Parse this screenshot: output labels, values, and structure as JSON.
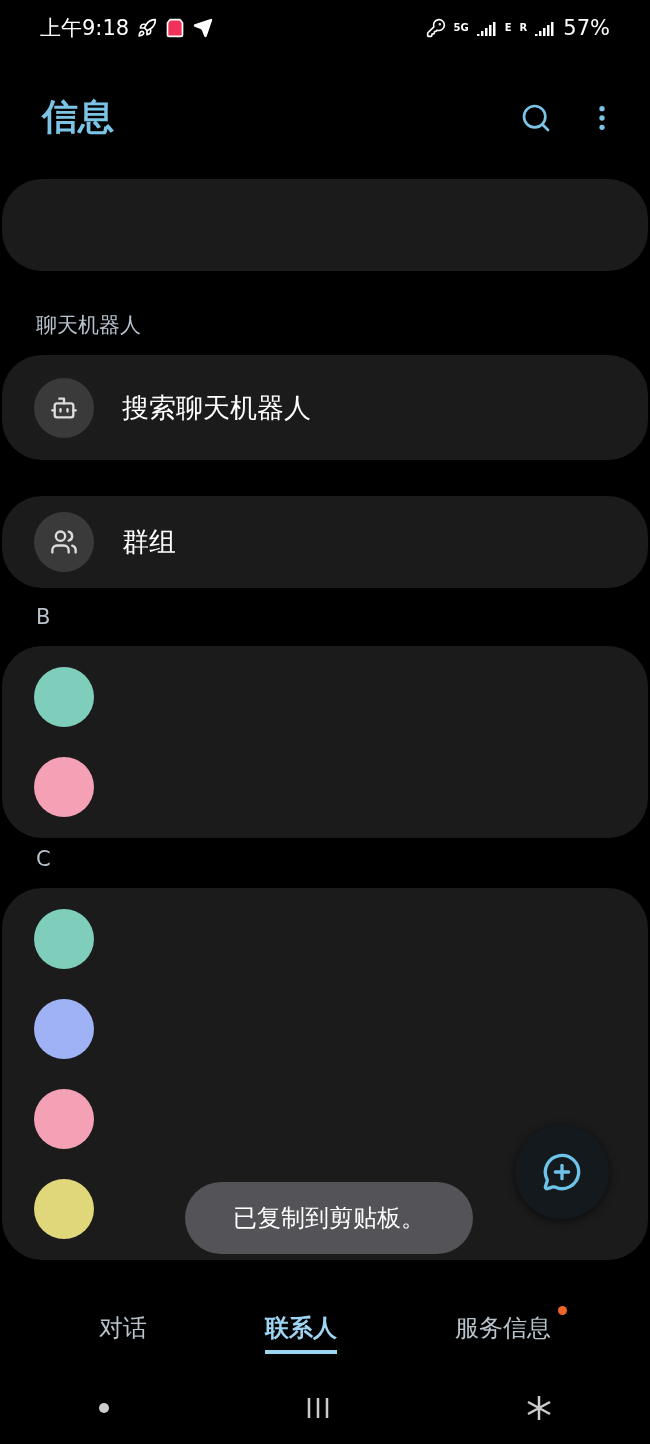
{
  "status_bar": {
    "time": "上午9:18",
    "network": "5G",
    "signal_label_1": "E",
    "signal_label_2": "R",
    "battery": "57%"
  },
  "header": {
    "title": "信息"
  },
  "sections": [
    {
      "kind": "blank"
    },
    {
      "kind": "group",
      "heading": "聊天机器人",
      "items": [
        {
          "kind": "bot",
          "label": "搜索聊天机器人"
        }
      ]
    },
    {
      "kind": "group",
      "items": [
        {
          "kind": "people",
          "label": "群组"
        }
      ]
    },
    {
      "kind": "contacts",
      "heading": "B",
      "items": [
        {
          "color": "#7fcdbb"
        },
        {
          "color": "#f4a0b5"
        }
      ]
    },
    {
      "kind": "contacts",
      "heading": "C",
      "items": [
        {
          "color": "#7fcdbb"
        },
        {
          "color": "#9fb2f5"
        },
        {
          "color": "#f4a0b5"
        },
        {
          "color": "#e0d67a"
        }
      ]
    }
  ],
  "toast": "已复制到剪贴板。",
  "tabs": [
    {
      "label": "对话",
      "selected": false,
      "badge": false
    },
    {
      "label": "联系人",
      "selected": true,
      "badge": false
    },
    {
      "label": "服务信息",
      "selected": false,
      "badge": true
    }
  ]
}
